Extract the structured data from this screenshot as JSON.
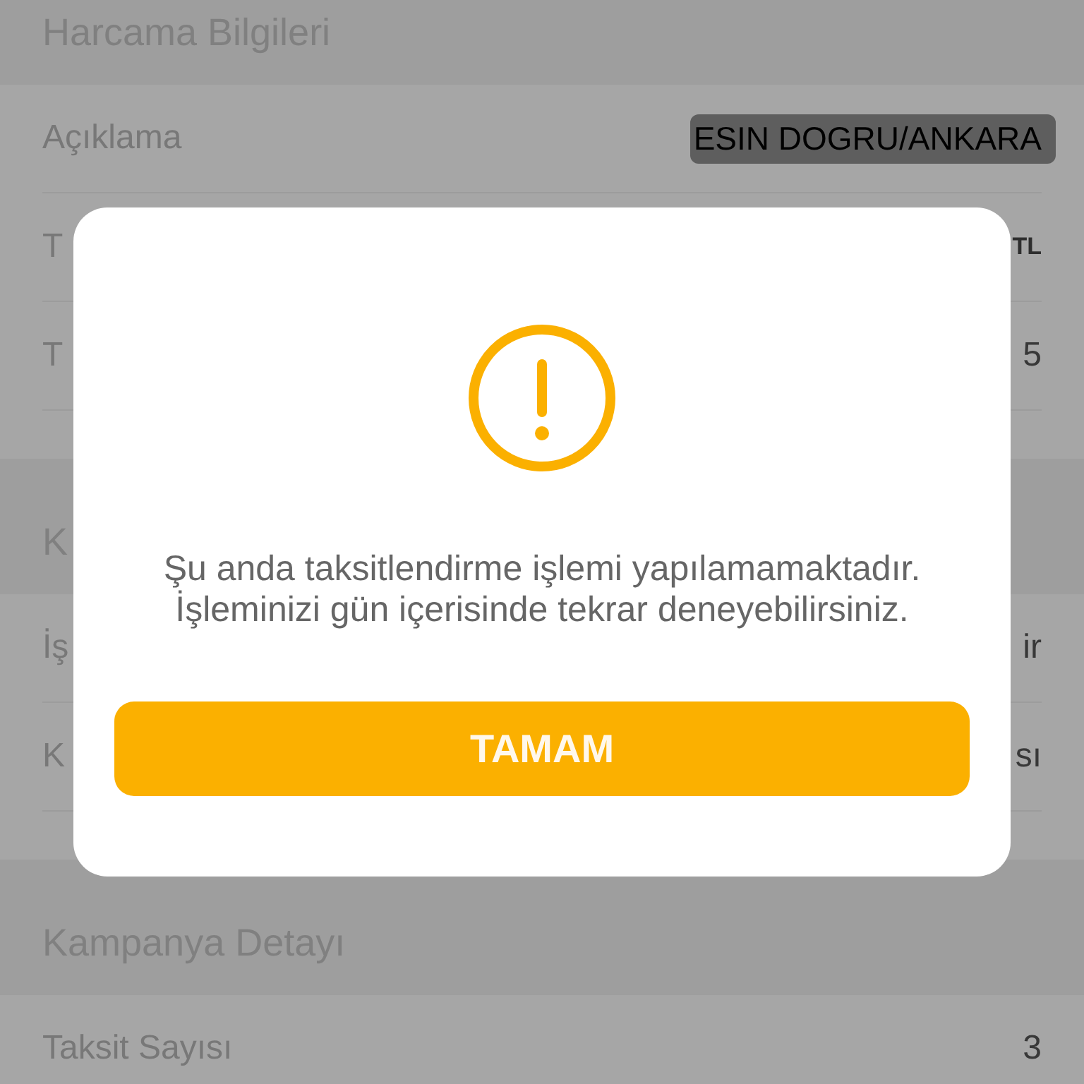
{
  "sections": [
    {
      "title": "Harcama Bilgileri",
      "rows": [
        {
          "label": "Açıklama",
          "value": "ESIN DOGRU/ANKARA",
          "bold": false,
          "scribbled": true
        },
        {
          "label": "T",
          "value": "TL",
          "bold": true,
          "scribbled": false
        },
        {
          "label": "T",
          "value": "5",
          "bold": false,
          "scribbled": false
        }
      ]
    },
    {
      "title": "K",
      "rows": [
        {
          "label": "İş",
          "value": "ir",
          "bold": false,
          "scribbled": false
        },
        {
          "label": "K",
          "value": "sı",
          "bold": false,
          "scribbled": false
        }
      ]
    },
    {
      "title": "Kampanya Detayı",
      "rows": [
        {
          "label": "Taksit Sayısı",
          "value": "3",
          "bold": false,
          "scribbled": false
        }
      ]
    }
  ],
  "dialog": {
    "message": "Şu anda taksitlendirme işlemi yapılamamaktadır.\nİşleminizi gün içerisinde tekrar deneyebilirsiniz.",
    "button": "TAMAM"
  }
}
